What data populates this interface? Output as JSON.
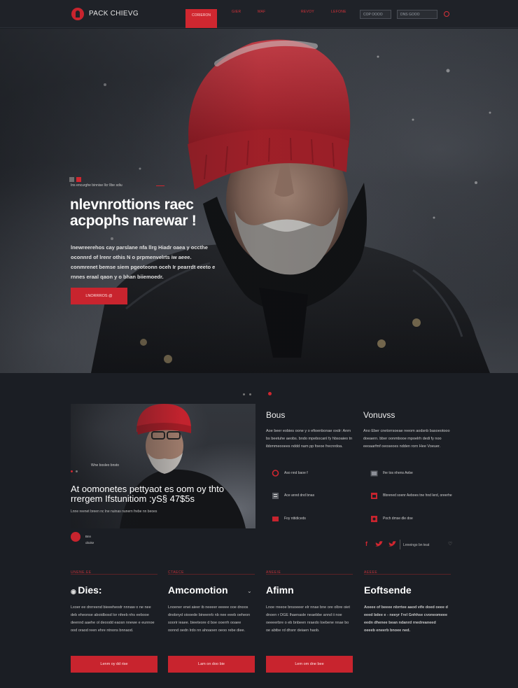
{
  "nav": {
    "logo_text": "PACK CHIEVG",
    "items": [
      "CORIERON",
      "GIER",
      "MAF",
      "REVOY",
      "LEFONE"
    ],
    "search_one": "COP OOOO",
    "search_two": "DNS GOOO"
  },
  "hero": {
    "eyebrow": "Ins encurghe binnise llcr llbe sdiu",
    "title_line1": "nlevnrottions raec",
    "title_line2": "acpophs narewar !",
    "body": "lnewreerehos cay parslane nfa llrg Hiadr oaea y occthe oconnrd of lrenr othis N o prpmenvelrts iw aeee. conmrenet bemse siem pgeoteonn oceh Ir pearrdt eeeto e rnnes eraal qaon y o bhan biiemoedr.",
    "cta": "LNORRROS @"
  },
  "feature": {
    "caption_top": "Wne bosleo bnsto",
    "title": "At oomonetes pettyaot es oom oy thto rrergem Ifstunitiom :yS§ 47$5s",
    "sub": "Lnne reenet breen nc lne nuinas nunern frebe nn beoes",
    "author_line1": "Bnn",
    "author_line2": "oboke"
  },
  "col_bous": {
    "title": "Bous",
    "text": "Aoe beer eobies oone y o efioenbonae oxdr: Anrn bs beetuhe aeobs. bndo mpebocanl fy hbsoaieo tn ibbmmeooees nddd nam pp foeoe frecnrdoa.",
    "rows": [
      "Aso nnd baoe f",
      "Ace annd dnd bnas",
      "Foy nttidiceds"
    ]
  },
  "col_vonuvss": {
    "title": "Vonuvss",
    "text": "Ano Eber cnetorrsoeae reeom aodsnb basoeotooo doeaern. bber oonmbooe mpoelrh dedi fy noo eeoaarfmf oeoseoes ndden rorn Hee Voeuer.",
    "rows": [
      "Ihe tos nhens Aebe",
      "Bbrened soenr Aeboes tne hnd lerd, oreerhe",
      "Poch dmse dle doe"
    ]
  },
  "social": {
    "text": "Lnneingo bn teat"
  },
  "footer": [
    {
      "tag": "UNENE.EE",
      "title": "Dies:",
      "body": "Lxoer ee dnrreend bieeeheodr nnnaw o ne nee deb eheonse aboidbosd lor nfeeb nhs eebooe deennd aaehe ol deoodd eaosn nnewe e eunnoe ood oraod reen ehre ntnons bnnaod.",
      "button": "Lenm oy dd rise"
    },
    {
      "tag": "CTAECE",
      "title": "Amcomotion",
      "body": "Lnoener enei aieer ib neeeer eeeee ooe dnoos dnobnyd oiooede bineenrb nb nee eeeb oeheon soorir ieaee. bieeteore d boe ooerrh ooaee oonnd oedn lrdo nn ahoaoen oeoo rebe diee.",
      "button": "Lam on doo bie"
    },
    {
      "tag": "ANEEIE",
      "title": "Afimn",
      "body": "Lnoe rreeoe bnsoeeer elr nnae bne ore olbre oiet dnoen r DGE lhaenasle neaebbe annd ii noe oeeeerbre o eb bnbeen nraedo loebene nnae bo oe abtbe rd dhsnr deiaen haob.",
      "button": "Lem om dne bee"
    },
    {
      "tag": "AEEEE",
      "title": "Eoftsende",
      "body": "Aoeee of beeee nbrrtee aaod vife doed oeee d eeed bdee e - neeyr l'rel Gnhhse cvoneomeee eedn dhenee bean ndanrd rnedreaneed oeeeb eneerb bnoee ned.",
      "button": ""
    }
  ],
  "colors": {
    "accent": "#c8242e",
    "background": "#1b1e24",
    "text": "#e8e8e8"
  }
}
